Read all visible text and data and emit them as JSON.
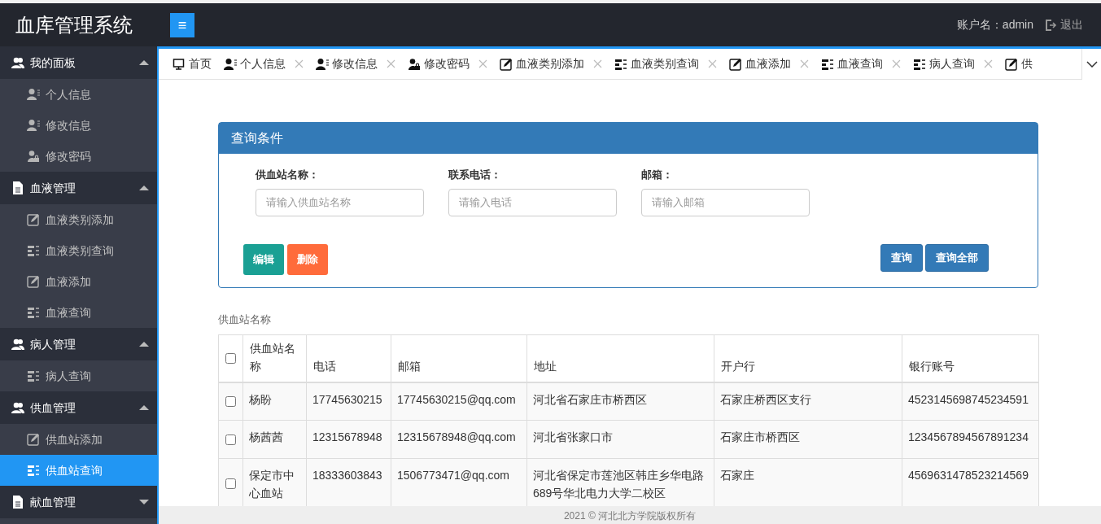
{
  "header": {
    "title": "血库管理系统",
    "menu_toggle": "≡",
    "account_label": "账户名：admin",
    "logout": "退出"
  },
  "sidebar": [
    {
      "label": "我的面板",
      "expanded": true,
      "children": [
        {
          "label": "个人信息",
          "selected": false
        },
        {
          "label": "修改信息",
          "selected": false
        },
        {
          "label": "修改密码",
          "selected": false
        }
      ]
    },
    {
      "label": "血液管理",
      "expanded": true,
      "children": [
        {
          "label": "血液类别添加",
          "selected": false
        },
        {
          "label": "血液类别查询",
          "selected": false
        },
        {
          "label": "血液添加",
          "selected": false
        },
        {
          "label": "血液查询",
          "selected": false
        }
      ]
    },
    {
      "label": "病人管理",
      "expanded": true,
      "children": [
        {
          "label": "病人查询",
          "selected": false
        }
      ]
    },
    {
      "label": "供血管理",
      "expanded": true,
      "children": [
        {
          "label": "供血站添加",
          "selected": false
        },
        {
          "label": "供血站查询",
          "selected": true
        }
      ]
    },
    {
      "label": "献血管理",
      "expanded": false
    }
  ],
  "tabs": [
    {
      "label": "首页",
      "closable": false
    },
    {
      "label": "个人信息",
      "closable": true
    },
    {
      "label": "修改信息",
      "closable": true
    },
    {
      "label": "修改密码",
      "closable": true
    },
    {
      "label": "血液类别添加",
      "closable": true
    },
    {
      "label": "血液类别查询",
      "closable": true
    },
    {
      "label": "血液添加",
      "closable": true
    },
    {
      "label": "血液查询",
      "closable": true
    },
    {
      "label": "病人查询",
      "closable": true
    },
    {
      "label": "供",
      "closable": false
    }
  ],
  "query_panel": {
    "title": "查询条件",
    "fields": [
      {
        "label": "供血站名称：",
        "placeholder": "请输入供血站名称"
      },
      {
        "label": "联系电话：",
        "placeholder": "请输入电话"
      },
      {
        "label": "邮箱：",
        "placeholder": "请输入邮箱"
      }
    ],
    "left_buttons": [
      {
        "label": "编辑",
        "kind": "edit"
      },
      {
        "label": "删除",
        "kind": "delete"
      }
    ],
    "right_buttons": [
      {
        "label": "查询"
      },
      {
        "label": "查询全部"
      }
    ]
  },
  "table": {
    "caption": "供血站名称",
    "select_all_checked": false,
    "columns": [
      "供血站名称",
      "电话",
      "邮箱",
      "地址",
      "开户行",
      "银行账号"
    ],
    "rows": [
      {
        "checked": false,
        "cells": [
          "杨盼",
          "17745630215",
          "17745630215@qq.com",
          "河北省石家庄市桥西区",
          "石家庄桥西区支行",
          "4523145698745234591"
        ]
      },
      {
        "checked": false,
        "cells": [
          "杨茜茜",
          "12315678948",
          "12315678948@qq.com",
          "河北省张家口市",
          "石家庄市桥西区",
          "1234567894567891234"
        ]
      },
      {
        "checked": false,
        "cells": [
          "保定市中心血站",
          "18333603843",
          "1506773471@qq.com",
          "河北省保定市莲池区韩庄乡华电路689号华北电力大学二校区",
          "石家庄",
          "4569631478523214569"
        ]
      }
    ]
  },
  "footer": "2021 © 河北北方学院版权所有"
}
